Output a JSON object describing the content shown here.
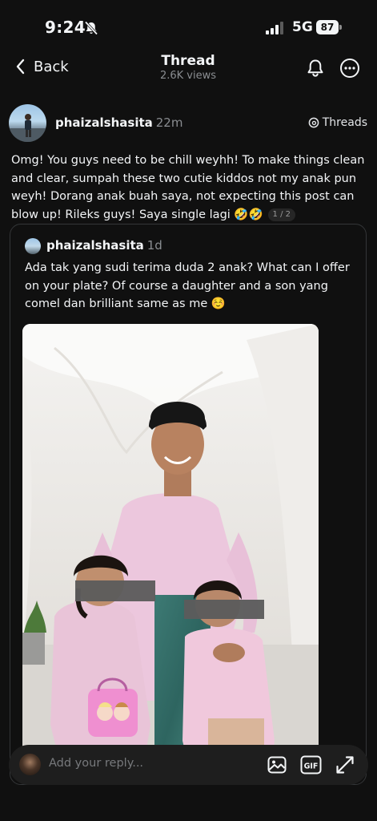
{
  "status": {
    "time": "9:24",
    "network": "5G",
    "battery": "87"
  },
  "header": {
    "back_label": "Back",
    "title": "Thread",
    "views": "2.6K views"
  },
  "post": {
    "username": "phaizalshasita",
    "time_ago": "22m",
    "source_label": "Threads",
    "text": "Omg! You guys need to be chill weyhh! To make things clean and clear, sumpah these two cutie kiddos not my anak pun weyh! Dorang anak buah saya, not expecting this post can blow up! Rileks guys! Saya single lagi 🤣🤣",
    "page_indicator": "1 / 2"
  },
  "quoted_post": {
    "username": "phaizalshasita",
    "time_ago": "1d",
    "text": "Ada tak yang sudi terima duda 2 anak? What can I offer on your plate? Of course a daughter and a son yang comel dan brilliant same as me ☺️"
  },
  "reply_bar": {
    "placeholder": "Add your reply...",
    "gif_label": "GIF"
  },
  "icons": {
    "back": "chevron-left-icon",
    "silent": "bell-slash-icon",
    "bell": "bell-icon",
    "more": "more-circle-icon",
    "threads": "threads-logo-icon",
    "image": "image-icon",
    "gif": "gif-icon",
    "expand": "expand-icon"
  },
  "colors": {
    "background": "#101010",
    "text": "#f3f5f7",
    "muted": "#8a8d91",
    "card_border": "#343638",
    "reply_bar": "#1e1e1e"
  }
}
